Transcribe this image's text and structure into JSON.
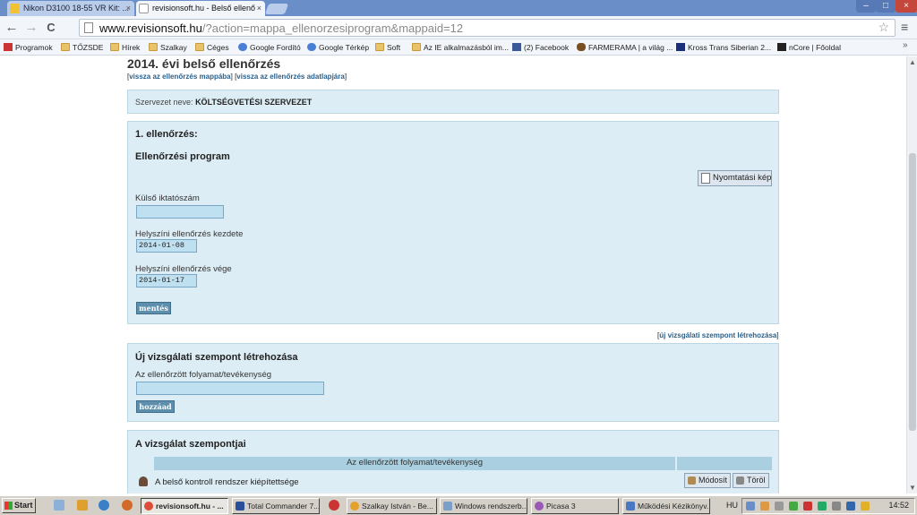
{
  "browser": {
    "tabs": [
      {
        "label": "Nikon D3100 18-55 VR Kit: ...",
        "active": false
      },
      {
        "label": "revisionsoft.hu - Belső ellenő",
        "active": true
      }
    ],
    "url_host": "www.revisionsoft.hu",
    "url_path": "/?action=mappa_ellenorzesiprogram&mappaid=12",
    "bookmarks": [
      "Programok",
      "TŐZSDE",
      "Hírek",
      "Szalkay",
      "Céges",
      "Google Fordító",
      "Google Térkép",
      "Soft",
      "Az IE alkalmazásból im...",
      "(2) Facebook",
      "FARMERAMA | a világ ...",
      "Kross Trans Siberian 2...",
      "nCore | Főoldal"
    ],
    "bookmarks_more": "»",
    "close_glyph": "×",
    "star_glyph": "☆",
    "menu_glyph": "≡",
    "back_glyph": "←",
    "forward_glyph": "→",
    "reload_glyph": "C",
    "min_glyph": "–",
    "max_glyph": "□",
    "winclose_glyph": "×"
  },
  "page": {
    "heading": "2014. évi belső ellenőrzés",
    "link_back_folder": "vissza az ellenőrzés mappába",
    "link_back_data": "vissza az ellenőrzés adatlapjára",
    "org_label": "Szervezet neve:",
    "org_name": "KÖLTSÉGVETÉSI SZERVEZET",
    "check_title": "1. ellenőrzés:",
    "program_title": "Ellenőrzési program",
    "print_button": "Nyomtatási kép",
    "ext_id_label": "Külső iktatószám",
    "ext_id_value": "",
    "onsite_start_label": "Helyszíni ellenőrzés kezdete",
    "onsite_start_value": "2014-01-08",
    "onsite_end_label": "Helyszíni ellenőrzés vége",
    "onsite_end_value": "2014-01-17",
    "save_button": "mentés",
    "new_point_link": "új vizsgálati szempont létrehozása",
    "new_point_title": "Új vizsgálati szempont létrehozása",
    "process_label": "Az ellenőrzött folyamat/tevékenység",
    "process_value": "",
    "add_button": "hozzáad",
    "points_title": "A vizsgálat szempontjai",
    "table_header": "Az ellenőrzött folyamat/tevékenység",
    "rows": [
      {
        "text": "A belső kontroll rendszer kiépítettsége",
        "modify": "Módosít",
        "delete": "Töröl"
      }
    ]
  },
  "taskbar": {
    "start": "Start",
    "tasks": [
      {
        "label": "revisionsoft.hu - ...",
        "pressed": true
      },
      {
        "label": "Total Commander 7....",
        "pressed": false
      },
      {
        "label": "Szalkay István - Be...",
        "pressed": false
      },
      {
        "label": "Windows rendszerb...",
        "pressed": false
      },
      {
        "label": "Picasa 3",
        "pressed": false
      },
      {
        "label": "Működési Kézikönyv...",
        "pressed": false
      }
    ],
    "lang": "HU",
    "clock": "14:52"
  }
}
